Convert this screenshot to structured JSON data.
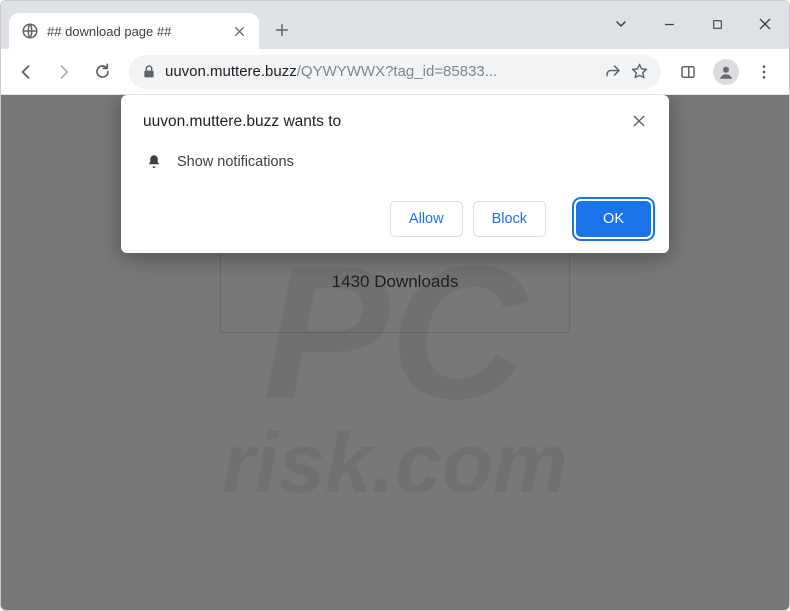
{
  "tab": {
    "title": "## download page ##"
  },
  "omnibox": {
    "host": "uuvon.muttere.buzz",
    "path": "/QYWYWWX?tag_id=85833..."
  },
  "page": {
    "downloads_label": "1430 Downloads"
  },
  "dialog": {
    "title": "uuvon.muttere.buzz wants to",
    "message": "Show notifications",
    "allow": "Allow",
    "block": "Block",
    "ok": "OK"
  },
  "watermark": {
    "line1": "PC",
    "line2": "risk.com"
  }
}
